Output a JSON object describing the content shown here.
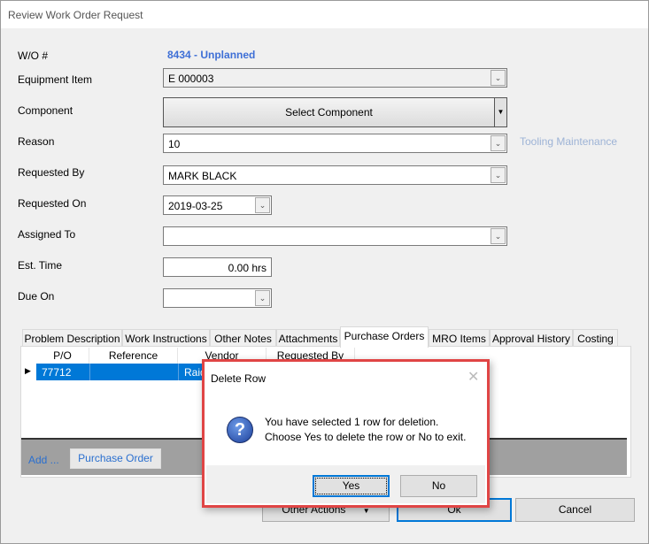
{
  "window": {
    "title": "Review Work Order Request"
  },
  "form": {
    "wo_label": "W/O #",
    "wo_value": "8434 - Unplanned",
    "equipment_label": "Equipment Item",
    "equipment_value": "E 000003",
    "component_label": "Component",
    "component_button": "Select Component",
    "reason_label": "Reason",
    "reason_value": "10",
    "reason_desc": "Tooling Maintenance",
    "requested_by_label": "Requested By",
    "requested_by_value": "MARK BLACK",
    "requested_on_label": "Requested On",
    "requested_on_value": "2019-03-25",
    "assigned_to_label": "Assigned To",
    "assigned_to_value": "",
    "est_time_label": "Est. Time",
    "est_time_value": "0.00 hrs",
    "due_on_label": "Due On",
    "due_on_value": ""
  },
  "tabs": [
    {
      "label": "Problem Description"
    },
    {
      "label": "Work Instructions"
    },
    {
      "label": "Other Notes"
    },
    {
      "label": "Attachments"
    },
    {
      "label": "Purchase Orders",
      "selected": true
    },
    {
      "label": "MRO Items"
    },
    {
      "label": "Approval History"
    },
    {
      "label": "Costing"
    }
  ],
  "grid": {
    "columns": [
      "P/O",
      "Reference",
      "Vendor",
      "Requested By"
    ],
    "rows": [
      {
        "po": "77712",
        "reference": "",
        "vendor": "Raid"
      }
    ]
  },
  "grid_footer": {
    "add_label": "Add ...",
    "purchase_order_button": "Purchase Order"
  },
  "buttons": {
    "other_actions": "Other Actions",
    "ok": "Ok",
    "cancel": "Cancel"
  },
  "dialog": {
    "title": "Delete Row",
    "message_line1": "You have selected 1 row for deletion.",
    "message_line2": "Choose Yes to delete the row or No to exit.",
    "yes": "Yes",
    "no": "No",
    "icon": "question-icon"
  },
  "colors": {
    "accent_link": "#3e6fd6",
    "selection": "#0078d7",
    "dialog_highlight": "#e04545"
  }
}
